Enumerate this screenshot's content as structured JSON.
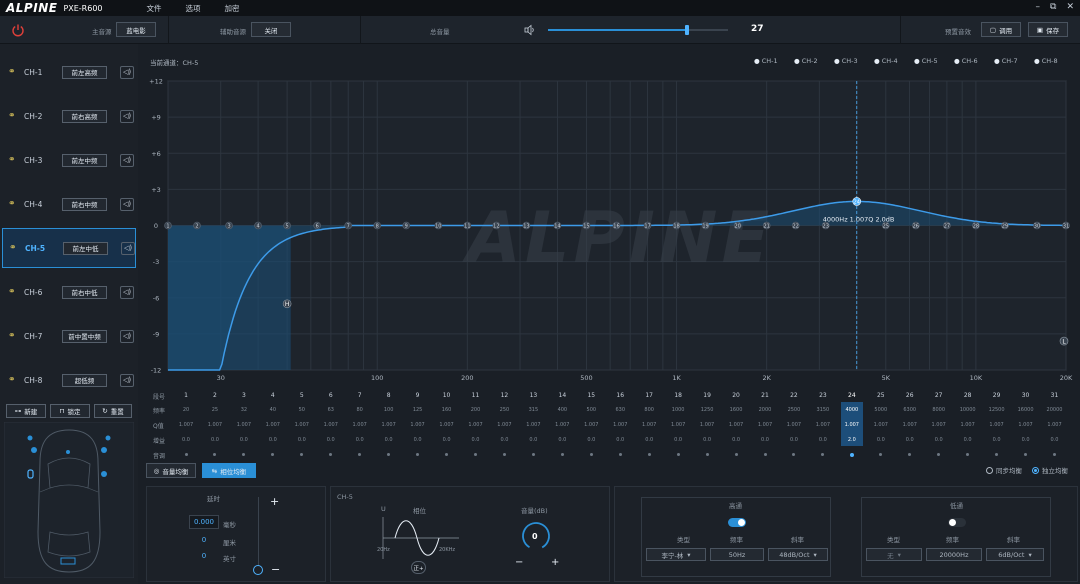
{
  "app": {
    "logo": "ALPINE",
    "model": "PXE-R600",
    "menus": [
      "文件",
      "选项",
      "加密"
    ],
    "window_controls": [
      "–",
      "⧉",
      "✕"
    ]
  },
  "toolbar": {
    "main_label": "主音源",
    "main_value": "蓝电影",
    "aux_label": "辅助音源",
    "aux_value": "关闭",
    "volume_label": "总音量",
    "volume_value": "27",
    "volume_fraction": 0.77,
    "preset_label": "预置音效",
    "recall_label": "调用",
    "save_label": "保存"
  },
  "channels": [
    {
      "name": "CH-1",
      "label": "前左高频"
    },
    {
      "name": "CH-2",
      "label": "前右高频"
    },
    {
      "name": "CH-3",
      "label": "前左中频"
    },
    {
      "name": "CH-4",
      "label": "前右中频"
    },
    {
      "name": "CH-5",
      "label": "前左中低"
    },
    {
      "name": "CH-6",
      "label": "前右中低"
    },
    {
      "name": "CH-7",
      "label": "前中置中频"
    },
    {
      "name": "CH-8",
      "label": "超低频"
    }
  ],
  "active_channel": 4,
  "sidebar_buttons": {
    "new": "新建",
    "lock": "锁定",
    "reset": "重置"
  },
  "graph": {
    "current_channel": "当前通道：CH-5",
    "legend": [
      "CH-1",
      "CH-2",
      "CH-3",
      "CH-4",
      "CH-5",
      "CH-6",
      "CH-7",
      "CH-8"
    ],
    "y_ticks": [
      "+12",
      "+9",
      "+6",
      "+3",
      "0",
      "-3",
      "-6",
      "-9",
      "-12"
    ],
    "x_ticks": [
      "30",
      "100",
      "200",
      "500",
      "1K",
      "2K",
      "5K",
      "10K",
      "20K"
    ],
    "watermark": "ALPINE",
    "tooltip": "4000Hz 1.007Q 2.0dB",
    "hp_marker": "H",
    "lp_marker": "L"
  },
  "table": {
    "row_labels": [
      "段号",
      "频率",
      "Q值",
      "增益",
      "音调"
    ],
    "bands": [
      "1",
      "2",
      "3",
      "4",
      "5",
      "6",
      "7",
      "8",
      "9",
      "10",
      "11",
      "12",
      "13",
      "14",
      "15",
      "16",
      "17",
      "18",
      "19",
      "20",
      "21",
      "22",
      "23",
      "24",
      "25",
      "26",
      "27",
      "28",
      "29",
      "30",
      "31"
    ],
    "freqs": [
      "20",
      "25",
      "32",
      "40",
      "50",
      "63",
      "80",
      "100",
      "125",
      "160",
      "200",
      "250",
      "315",
      "400",
      "500",
      "630",
      "800",
      "1000",
      "1250",
      "1600",
      "2000",
      "2500",
      "3150",
      "4000",
      "5000",
      "6300",
      "8000",
      "10000",
      "12500",
      "16000",
      "20000"
    ],
    "q_value": "1.007",
    "gain_value": "0.0",
    "active_band_gain": "2.0",
    "active_band": 23
  },
  "graph_buttons": {
    "balance": "音量均衡",
    "phase": "相位均衡"
  },
  "graph_toggles": {
    "sync": "同步均衡",
    "own": "独立均衡"
  },
  "delay": {
    "title": "延时",
    "ms_value": "0.000",
    "ms_unit": "毫秒",
    "cm_value": "0",
    "cm_unit": "厘米",
    "inch_value": "0",
    "inch_unit": "英寸",
    "plus": "+",
    "minus": "−"
  },
  "phase": {
    "channel": "CH-5",
    "label": "相位",
    "u_axis": "U",
    "f_low": "20Hz",
    "f_high": "20KHz",
    "button": "正+"
  },
  "gain": {
    "title": "音量(dB)",
    "value": "0",
    "minus": "−",
    "plus": "+"
  },
  "highpass": {
    "title": "高通",
    "type_label": "类型",
    "freq_label": "频率",
    "slope_label": "斜率",
    "type": "李宁-林",
    "freq": "50Hz",
    "slope": "48dB/Oct",
    "enabled": true
  },
  "lowpass": {
    "title": "低通",
    "type_label": "类型",
    "freq_label": "频率",
    "slope_label": "斜率",
    "type": "无",
    "freq": "20000Hz",
    "slope": "6dB/Oct",
    "enabled": false
  },
  "colors": {
    "accent": "#2a8fd6",
    "curve": "#3d9be9",
    "fill": "#1b4c73"
  }
}
